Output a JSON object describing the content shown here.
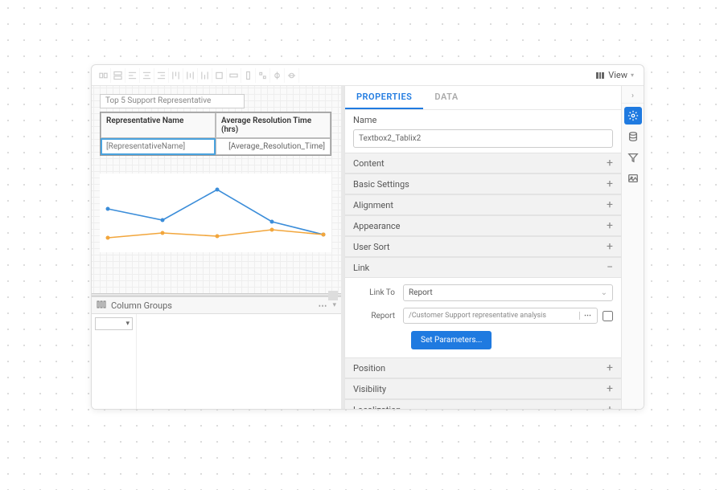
{
  "toolbar": {
    "view_label": "View"
  },
  "canvas": {
    "title_text": "Top 5 Support Representative",
    "col1": "Representative Name",
    "col2": "Average Resolution Time (hrs)",
    "cell1": "[RepresentativeName]",
    "cell2": "[Average_Resolution_Time]",
    "groups_header": "Column Groups"
  },
  "props": {
    "tab_properties": "PROPERTIES",
    "tab_data": "DATA",
    "name_label": "Name",
    "name_value": "Textbox2_Tablix2",
    "sections": {
      "content": "Content",
      "basic": "Basic Settings",
      "alignment": "Alignment",
      "appearance": "Appearance",
      "usersort": "User Sort",
      "link": "Link",
      "position": "Position",
      "visibility": "Visibility",
      "localization": "Localization"
    },
    "link": {
      "link_to_label": "Link To",
      "link_to_value": "Report",
      "report_label": "Report",
      "report_value": "/Customer Support representative analysis",
      "set_params": "Set Parameters..."
    }
  },
  "chart_data": {
    "type": "line",
    "x": [
      0,
      1,
      2,
      3,
      4
    ],
    "series": [
      {
        "name": "blue",
        "color": "#3b8dd9",
        "values": [
          56,
          45,
          78,
          38,
          24
        ]
      },
      {
        "name": "orange",
        "color": "#f2a63c",
        "values": [
          20,
          26,
          22,
          30,
          24
        ]
      }
    ],
    "ylim": [
      0,
      100
    ]
  }
}
